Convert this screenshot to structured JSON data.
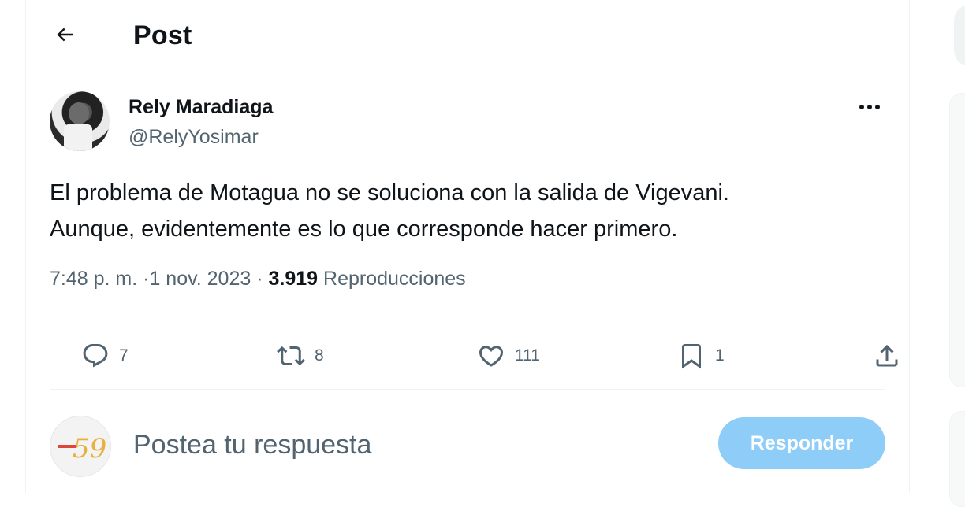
{
  "header": {
    "title": "Post"
  },
  "post": {
    "author": {
      "name": "Rely Maradiaga",
      "handle": "@RelyYosimar"
    },
    "text_line1": "El problema de Motagua no se soluciona con la salida de Vigevani.",
    "text_line2": "Aunque, evidentemente es lo que corresponde hacer primero.",
    "time": "7:48 p. m.",
    "separator": "·",
    "date": "1 nov. 2023",
    "views": "3.919",
    "views_label": "Reproducciones"
  },
  "actions": {
    "replies": "7",
    "reposts": "8",
    "likes": "111",
    "bookmarks": "1"
  },
  "reply": {
    "placeholder": "Postea tu respuesta",
    "button_label": "Responder"
  },
  "colors": {
    "text": "#0f1419",
    "secondary": "#536471",
    "button_disabled": "#8ecdf8",
    "divider": "#eff3f4"
  },
  "icons": [
    "back-arrow-icon",
    "more-icon",
    "reply-icon",
    "repost-icon",
    "like-icon",
    "bookmark-icon",
    "share-icon"
  ]
}
